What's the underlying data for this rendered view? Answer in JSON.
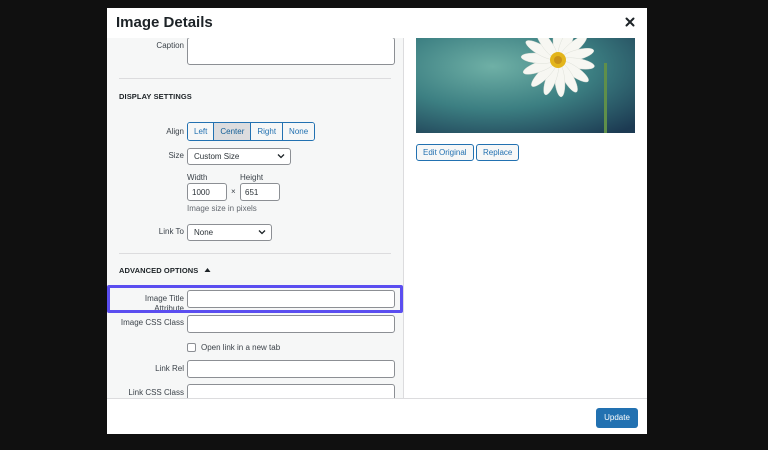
{
  "modal": {
    "title": "Image Details",
    "close_icon": "close-icon"
  },
  "caption": {
    "label": "Caption",
    "value": ""
  },
  "display_settings": {
    "title": "DISPLAY SETTINGS",
    "align": {
      "label": "Align",
      "options": [
        "Left",
        "Center",
        "Right",
        "None"
      ],
      "selected": "Center"
    },
    "size": {
      "label": "Size",
      "value": "Custom Size"
    },
    "width": {
      "label": "Width",
      "value": "1000"
    },
    "height": {
      "label": "Height",
      "value": "651"
    },
    "times": "×",
    "size_hint": "Image size in pixels",
    "link_to": {
      "label": "Link To",
      "value": "None"
    }
  },
  "advanced_options": {
    "title": "ADVANCED OPTIONS",
    "toggle_icon": "triangle-up-icon",
    "image_title_attribute": {
      "label_line1": "Image Title",
      "label_line2": "Attribute",
      "value": ""
    },
    "image_css_class": {
      "label": "Image CSS Class",
      "value": ""
    },
    "open_new_tab": {
      "label": "Open link in a new tab",
      "checked": false
    },
    "link_rel": {
      "label": "Link Rel",
      "value": ""
    },
    "link_css_class": {
      "label": "Link CSS Class",
      "value": ""
    }
  },
  "preview": {
    "edit_original": "Edit Original",
    "replace": "Replace"
  },
  "footer": {
    "update": "Update"
  },
  "colors": {
    "accent": "#2271b1",
    "highlight": "#5b4ef0",
    "backdrop": "#101010"
  }
}
